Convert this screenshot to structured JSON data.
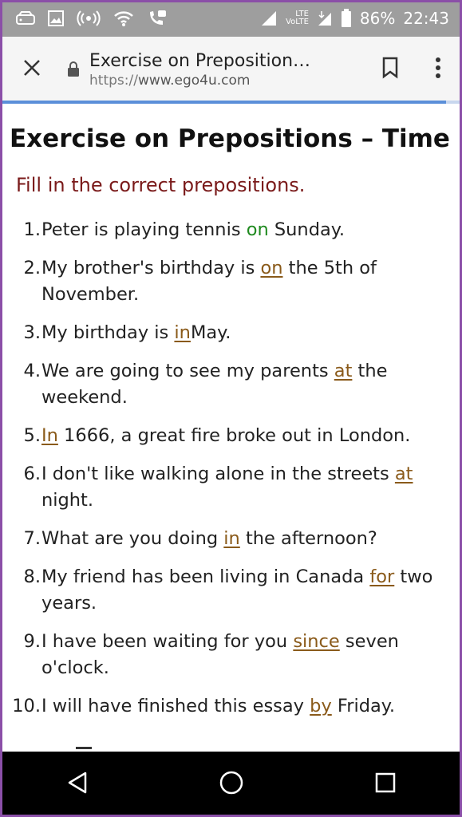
{
  "status_bar": {
    "icons": [
      "drive-icon",
      "image-icon",
      "hotspot-icon",
      "wifi-icon",
      "call-forward-icon",
      "signal-icon",
      "volte-icon",
      "lte-signal-icon",
      "battery-icon"
    ],
    "volte_label": "VoLTE",
    "lte_label": "LTE",
    "battery": "86%",
    "time": "22:43"
  },
  "browser": {
    "page_title": "Exercise on Preposition…",
    "url_scheme": "https://",
    "url_host": "www.ego4u.com",
    "load_progress": 0.965
  },
  "page": {
    "heading": "Exercise on Prepositions – Time",
    "instruction": "Fill in the correct prepositions.",
    "items": [
      {
        "num": "1.",
        "before": "Peter is playing tennis ",
        "answer": "on",
        "after": " Sunday."
      },
      {
        "num": "2.",
        "before": "My brother's birthday is ",
        "answer": "on",
        "after": " the 5th of November."
      },
      {
        "num": "3.",
        "before": "My birthday is ",
        "answer": "in",
        "after": "May."
      },
      {
        "num": "4.",
        "before": "We are going to see my parents ",
        "answer": "at",
        "after": " the weekend."
      },
      {
        "num": "5.",
        "before": "",
        "answer": "In",
        "after": " 1666, a great fire broke out in London."
      },
      {
        "num": "6.",
        "before": "I don't like walking alone in the streets ",
        "answer": "at",
        "after": " night."
      },
      {
        "num": "7.",
        "before": "What are you doing ",
        "answer": "in",
        "after": " the afternoon?"
      },
      {
        "num": "8.",
        "before": "My friend has been living in Canada ",
        "answer": "for",
        "after": " two years."
      },
      {
        "num": "9.",
        "before": "I have been waiting for you ",
        "answer": "since",
        "after": " seven o'clock."
      },
      {
        "num": "10.",
        "before": "I will have finished this essay ",
        "answer": "by",
        "after": " Friday."
      }
    ]
  },
  "colors": {
    "status_bar_bg": "#9e9e9e",
    "instruction": "#7a1a1a",
    "answer_correct": "#1f8a1f",
    "answer": "#8a5a1a",
    "progress": "#5b8fd9"
  }
}
